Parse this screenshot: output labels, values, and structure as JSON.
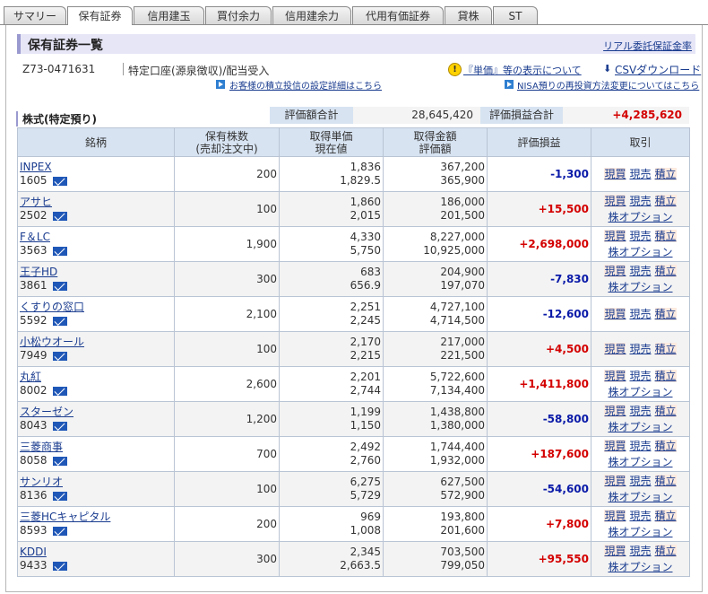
{
  "tabs": [
    "サマリー",
    "保有証券",
    "信用建玉",
    "買付余力",
    "信用建余力",
    "代用有価証券",
    "貸株",
    "ST"
  ],
  "active_tab": 1,
  "header": {
    "title": "保有証券一覧",
    "link": "リアル委託保証金率"
  },
  "account": {
    "id": "Z73-0471631",
    "type": "特定口座(源泉徴収)/配当受入",
    "unit_link": "『単価』等の表示について",
    "csv_link": "CSVダウンロード",
    "reinvest_link": "お客様の積立投信の設定詳細はこちら",
    "nisa_link": "NISA預りの再投資方法変更についてはこちら"
  },
  "section": {
    "label": "株式(特定預り)",
    "valuation_label": "評価額合計",
    "valuation_value": "28,645,420",
    "pnl_label": "評価損益合計",
    "pnl_value": "+4,285,620"
  },
  "columns": {
    "name": "銘柄",
    "qty1": "保有株数",
    "qty2": "(売却注文中)",
    "unit1": "取得単価",
    "unit2": "現在値",
    "amt1": "取得金額",
    "amt2": "評価額",
    "pnl": "評価損益",
    "trade": "取引"
  },
  "actions": {
    "buy": "現買",
    "sell": "現売",
    "accum": "積立",
    "option": "株オプション"
  },
  "rows": [
    {
      "name": "INPEX",
      "code": "1605",
      "qty": "200",
      "cost": "1,836",
      "price": "1,829.5",
      "cost_amt": "367,200",
      "val": "365,900",
      "pnl": "-1,300",
      "opt": false
    },
    {
      "name": "アサヒ",
      "code": "2502",
      "qty": "100",
      "cost": "1,860",
      "price": "2,015",
      "cost_amt": "186,000",
      "val": "201,500",
      "pnl": "+15,500",
      "opt": true
    },
    {
      "name": "F＆LC",
      "code": "3563",
      "qty": "1,900",
      "cost": "4,330",
      "price": "5,750",
      "cost_amt": "8,227,000",
      "val": "10,925,000",
      "pnl": "+2,698,000",
      "opt": true
    },
    {
      "name": "王子HD",
      "code": "3861",
      "qty": "300",
      "cost": "683",
      "price": "656.9",
      "cost_amt": "204,900",
      "val": "197,070",
      "pnl": "-7,830",
      "opt": true
    },
    {
      "name": "くすりの窓口",
      "code": "5592",
      "qty": "2,100",
      "cost": "2,251",
      "price": "2,245",
      "cost_amt": "4,727,100",
      "val": "4,714,500",
      "pnl": "-12,600",
      "opt": false
    },
    {
      "name": "小松ウオール",
      "code": "7949",
      "qty": "100",
      "cost": "2,170",
      "price": "2,215",
      "cost_amt": "217,000",
      "val": "221,500",
      "pnl": "+4,500",
      "opt": false
    },
    {
      "name": "丸紅",
      "code": "8002",
      "qty": "2,600",
      "cost": "2,201",
      "price": "2,744",
      "cost_amt": "5,722,600",
      "val": "7,134,400",
      "pnl": "+1,411,800",
      "opt": true
    },
    {
      "name": "スターゼン",
      "code": "8043",
      "qty": "1,200",
      "cost": "1,199",
      "price": "1,150",
      "cost_amt": "1,438,800",
      "val": "1,380,000",
      "pnl": "-58,800",
      "opt": true
    },
    {
      "name": "三菱商事",
      "code": "8058",
      "qty": "700",
      "cost": "2,492",
      "price": "2,760",
      "cost_amt": "1,744,400",
      "val": "1,932,000",
      "pnl": "+187,600",
      "opt": true
    },
    {
      "name": "サンリオ",
      "code": "8136",
      "qty": "100",
      "cost": "6,275",
      "price": "5,729",
      "cost_amt": "627,500",
      "val": "572,900",
      "pnl": "-54,600",
      "opt": true
    },
    {
      "name": "三菱HCキャピタル",
      "code": "8593",
      "qty": "200",
      "cost": "969",
      "price": "1,008",
      "cost_amt": "193,800",
      "val": "201,600",
      "pnl": "+7,800",
      "opt": true
    },
    {
      "name": "KDDI",
      "code": "9433",
      "qty": "300",
      "cost": "2,345",
      "price": "2,663.5",
      "cost_amt": "703,500",
      "val": "799,050",
      "pnl": "+95,550",
      "opt": true
    }
  ]
}
